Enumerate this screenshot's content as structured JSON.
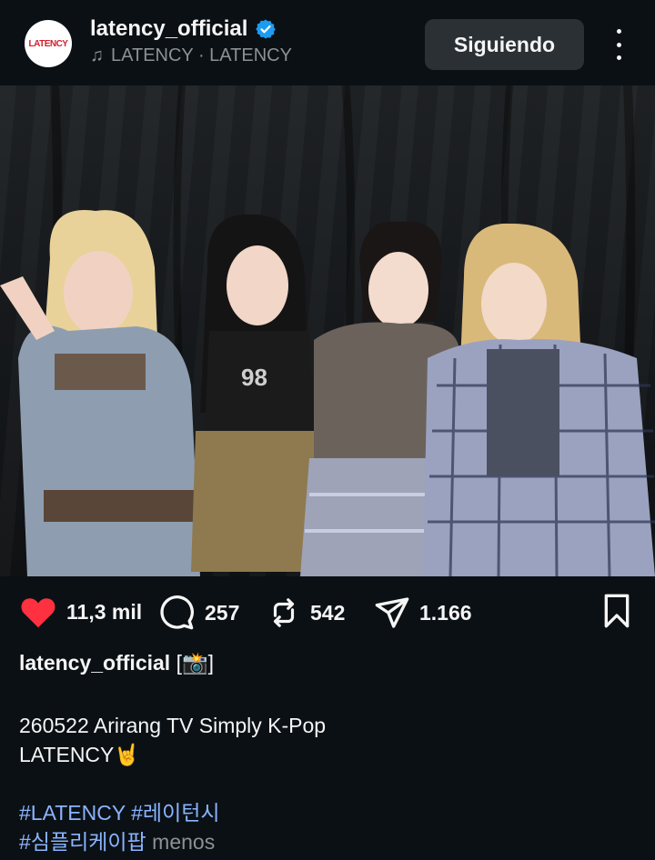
{
  "post": {
    "username": "latency_official",
    "avatar_text": "LATENCY",
    "music": "LATENCY · LATENCY",
    "follow_label": "Siguiendo"
  },
  "stats": {
    "likes": "11,3 mil",
    "comments": "257",
    "reposts": "542",
    "shares": "1.166"
  },
  "caption": {
    "username": "latency_official",
    "username_suffix": " [📸]",
    "line1": "260522  Arirang TV Simply K-Pop",
    "line2": "LATENCY🤘",
    "hashtags_line1": "#LATENCY #레이턴시",
    "hashtags_line2": "#심플리케이팝",
    "less_label": "menos"
  },
  "colors": {
    "like": "#ff3040",
    "hashtag": "#8ab4ff",
    "verified": "#1d9bf0"
  },
  "icons": [
    "verified-badge-icon",
    "music-note-icon",
    "more-options-icon",
    "heart-icon",
    "comment-icon",
    "repost-icon",
    "share-icon",
    "bookmark-icon",
    "mute-icon"
  ]
}
